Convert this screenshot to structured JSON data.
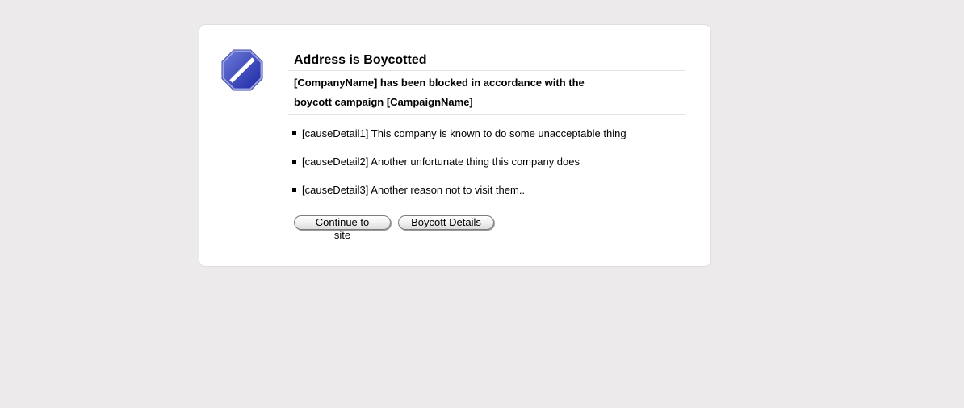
{
  "dialog": {
    "title": "Address is Boycotted",
    "message_line1": "[CompanyName] has been blocked in accordance with the",
    "message_line2": "boycott campaign [CampaignName]",
    "icon": "no-entry-sign-icon",
    "causes": [
      {
        "text": "[causeDetail1]  This company is known to do some unacceptable thing"
      },
      {
        "text": "[causeDetail2] Another unfortunate thing this company does"
      },
      {
        "text": "[causeDetail3] Another reason not to visit them.."
      }
    ],
    "buttons": {
      "continue_label": "Continue to site",
      "details_label": "Boycott Details"
    }
  },
  "colors": {
    "background": "#eceaea",
    "icon_blue": "#2a3cb8"
  }
}
